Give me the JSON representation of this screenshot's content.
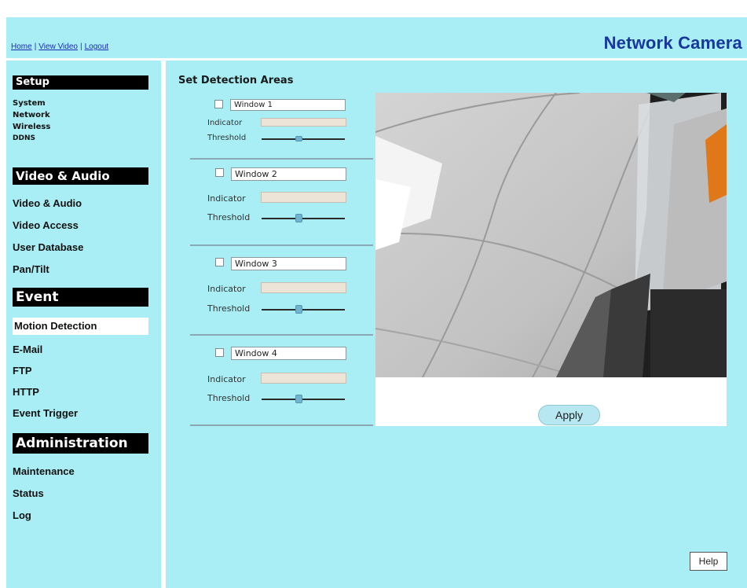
{
  "header": {
    "links": [
      "Home",
      "View Video",
      "Logout"
    ],
    "separator": "|",
    "brand": "Network Camera"
  },
  "sidebar": {
    "sections": [
      {
        "title": "Setup",
        "items": [
          "System",
          "Network",
          "Wireless",
          "DDNS"
        ]
      },
      {
        "title": "Video & Audio",
        "items": [
          "Video & Audio",
          "Video Access",
          "User Database",
          "Pan/Tilt"
        ]
      },
      {
        "title": "Event",
        "items": [
          "Motion Detection",
          "E-Mail",
          "FTP",
          "HTTP",
          "Event Trigger"
        ]
      },
      {
        "title": "Administration",
        "items": [
          "Maintenance",
          "Status",
          "Log"
        ]
      }
    ],
    "active_item": "Motion Detection"
  },
  "main": {
    "title": "Set Detection Areas",
    "indicator_label": "Indicator",
    "threshold_label": "Threshold",
    "windows": [
      {
        "name": "Window 1",
        "checked": false,
        "threshold": 0.45
      },
      {
        "name": "Window 2",
        "checked": false,
        "threshold": 0.45
      },
      {
        "name": "Window 3",
        "checked": false,
        "threshold": 0.45
      },
      {
        "name": "Window 4",
        "checked": false,
        "threshold": 0.45
      }
    ],
    "apply_label": "Apply",
    "help_label": "Help"
  },
  "colors": {
    "page_bg": "#a9eef4",
    "brand": "#17379f",
    "link": "#1a2bb5",
    "section_header_bg": "#000000"
  },
  "icons": [
    "checkbox-icon",
    "slider-knob-icon"
  ]
}
